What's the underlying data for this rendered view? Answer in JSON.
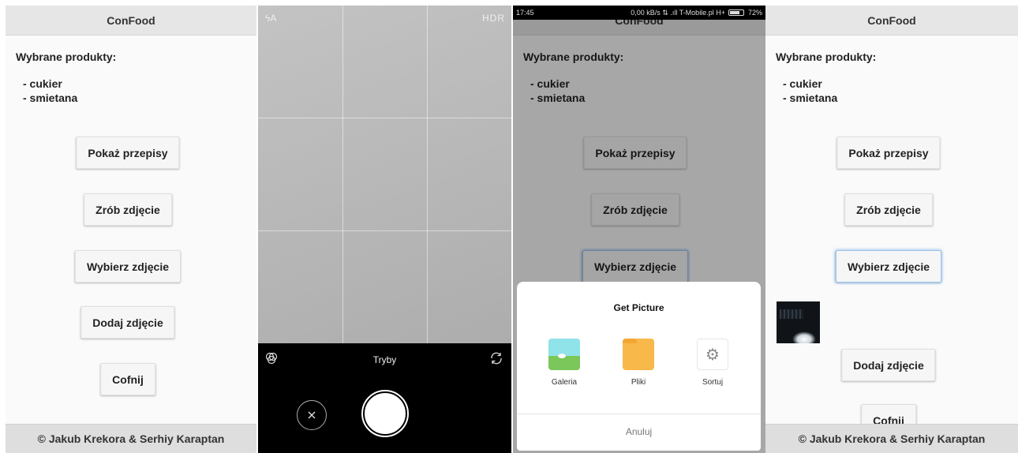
{
  "app": {
    "title": "ConFood",
    "section_title": "Wybrane produkty:",
    "products": [
      "- cukier",
      "- smietana"
    ],
    "buttons": {
      "show_recipes": "Pokaż przepisy",
      "take_photo": "Zrób zdjęcie",
      "choose_photo": "Wybierz zdjęcie",
      "add_photo": "Dodaj zdjęcie",
      "back": "Cofnij"
    },
    "footer": "© Jakub Krekora & Serhiy Karaptan"
  },
  "camera": {
    "flash_icon": "flash-auto-icon",
    "flash_label": "ϟA",
    "hdr_label": "HDR",
    "modes_label": "Tryby",
    "filter_icon": "filters-icon",
    "switch_icon": "switch-camera-icon"
  },
  "status_bar": {
    "time": "17:45",
    "info": "0,00 kB/s ⇅ .ıll T-Mobile.pl H+",
    "battery": "72%"
  },
  "picker": {
    "title": "Get Picture",
    "options": [
      {
        "label": "Galeria",
        "icon": "gallery-icon"
      },
      {
        "label": "Pliki",
        "icon": "folder-icon"
      },
      {
        "label": "Sortuj",
        "icon": "gear-icon"
      }
    ],
    "cancel": "Anuluj"
  },
  "colors": {
    "header_bg": "#e6e6e6",
    "footer_bg": "#dedede",
    "focus_ring": "#7fb0e8",
    "folder": "#f8b84a"
  }
}
